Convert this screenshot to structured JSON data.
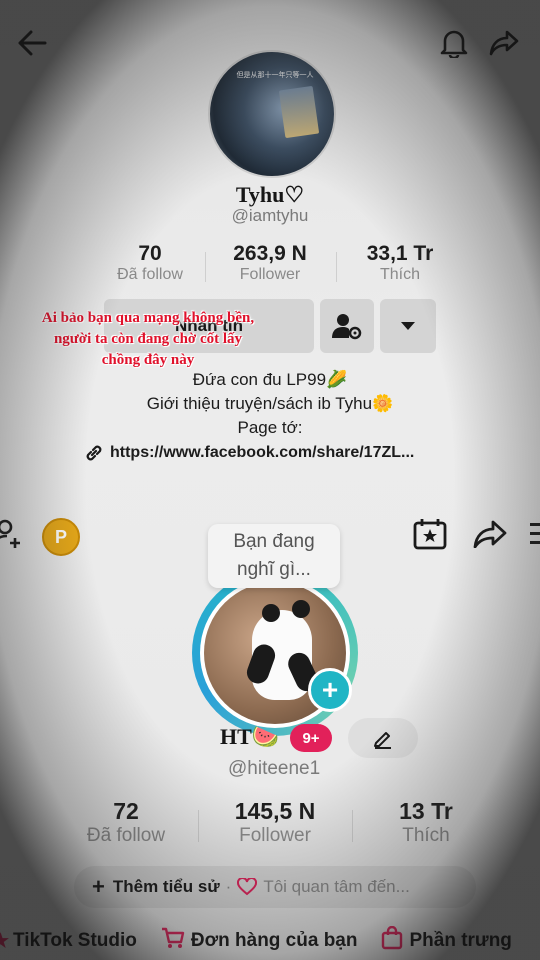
{
  "top_profile": {
    "avatar_caption": "但是从那十一年只等一人",
    "name": "Tyhu♡",
    "handle": "@iamtyhu",
    "stats": [
      {
        "value": "70",
        "label": "Đã follow"
      },
      {
        "value": "263,9 N",
        "label": "Follower"
      },
      {
        "value": "33,1 Tr",
        "label": "Thích"
      }
    ],
    "message_button": "Nhắn tin",
    "bio_lines": [
      "Đứa con đu LP99🌽",
      "Giới thiệu truyện/sách ib Tyhu🌼",
      "Page tớ:"
    ],
    "link": "https://www.facebook.com/share/17ZL..."
  },
  "overlay_caption": {
    "line1": "Ai bảo bạn qua mạng không bền,",
    "line2": "người ta còn đang chờ cốt lấy",
    "line3": "chồng đây này"
  },
  "own_profile": {
    "coin_label": "P",
    "thought_bubble_line1": "Bạn đang",
    "thought_bubble_line2": "nghĩ gì...",
    "name": "HT🍉",
    "notification_badge": "9+",
    "handle": "@hiteene1",
    "stats": [
      {
        "value": "72",
        "label": "Đã follow"
      },
      {
        "value": "145,5 N",
        "label": "Follower"
      },
      {
        "value": "13 Tr",
        "label": "Thích"
      }
    ],
    "add_bio": "Thêm tiểu sử",
    "separator": "·",
    "interests": "Tôi quan tâm đến..."
  },
  "bottom_bar": {
    "studio": "TikTok Studio",
    "orders": "Đơn hàng của bạn",
    "products": "Phần trưng"
  },
  "colors": {
    "accent_teal": "#20b5c5",
    "badge_red": "#e2215a",
    "caption_red": "#e0112b"
  }
}
